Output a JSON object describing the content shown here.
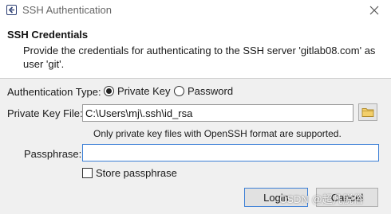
{
  "window": {
    "title": "SSH Authentication"
  },
  "header": {
    "title": "SSH Credentials",
    "message": "Provide the credentials for authenticating to the SSH server 'gitlab08.com' as user 'git'."
  },
  "auth_type": {
    "label": "Authentication Type:",
    "options": [
      {
        "label": "Private Key",
        "selected": true
      },
      {
        "label": "Password",
        "selected": false
      }
    ]
  },
  "private_key": {
    "label": "Private Key File:",
    "value": "C:\\Users\\mj\\.ssh\\id_rsa",
    "hint": "Only private key files with OpenSSH format are supported.",
    "browse_icon": "folder-icon"
  },
  "passphrase": {
    "label": "Passphrase:",
    "value": ""
  },
  "store_passphrase": {
    "label": "Store passphrase",
    "checked": false
  },
  "buttons": {
    "login": "Login",
    "cancel": "Cancel"
  },
  "watermark": "CSDN @超凡脱俗",
  "colors": {
    "focus_border": "#3c7fd6",
    "dialog_bg": "#f0f0f0",
    "title_text": "#666666"
  }
}
